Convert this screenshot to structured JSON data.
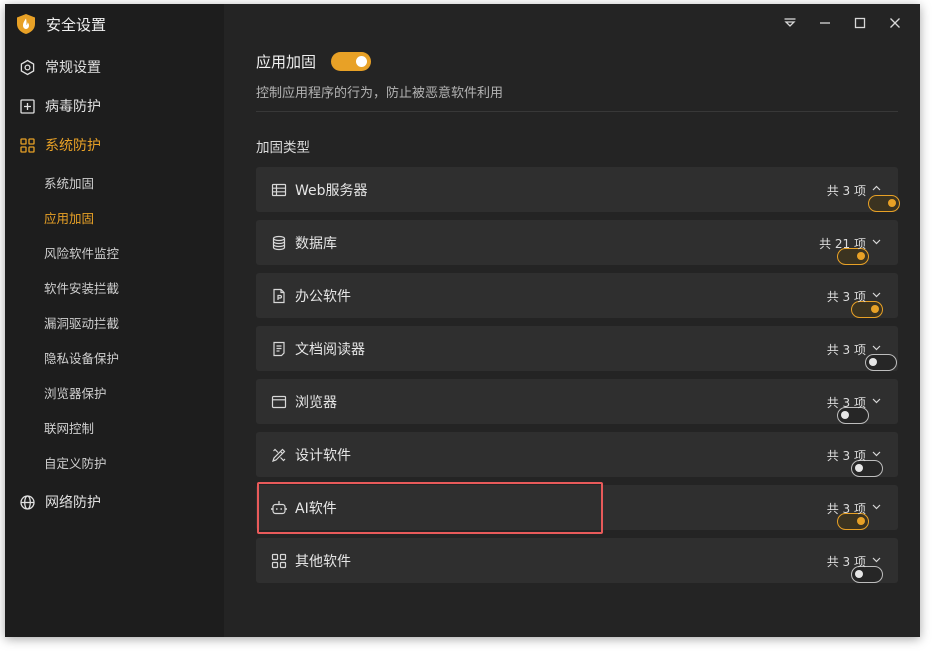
{
  "app": {
    "title": "安全设置"
  },
  "sidebar": {
    "nav": [
      {
        "label": "常规设置",
        "icon": "settings-icon"
      },
      {
        "label": "病毒防护",
        "icon": "plus-square-icon"
      },
      {
        "label": "系统防护",
        "icon": "grid-icon"
      },
      {
        "label": "网络防护",
        "icon": "globe-icon"
      }
    ],
    "sub_items": [
      "系统加固",
      "应用加固",
      "风险软件监控",
      "软件安装拦截",
      "漏洞驱动拦截",
      "隐私设备保护",
      "浏览器保护",
      "联网控制",
      "自定义防护"
    ],
    "active_nav": "系统防护",
    "active_sub": "应用加固"
  },
  "main": {
    "title": "应用加固",
    "enabled": true,
    "description": "控制应用程序的行为，防止被恶意软件利用",
    "section_label": "加固类型",
    "categories": [
      {
        "name": "Web服务器",
        "enabled": true,
        "count": "共 3 项",
        "expanded": true,
        "icon": "server-icon"
      },
      {
        "name": "数据库",
        "enabled": true,
        "count": "共 21 项",
        "expanded": false,
        "icon": "database-icon"
      },
      {
        "name": "办公软件",
        "enabled": true,
        "count": "共 3 项",
        "expanded": false,
        "icon": "office-file-icon"
      },
      {
        "name": "文档阅读器",
        "enabled": false,
        "count": "共 3 项",
        "expanded": false,
        "icon": "document-icon"
      },
      {
        "name": "浏览器",
        "enabled": false,
        "count": "共 3 项",
        "expanded": false,
        "icon": "browser-icon"
      },
      {
        "name": "设计软件",
        "enabled": false,
        "count": "共 3 项",
        "expanded": false,
        "icon": "design-tools-icon"
      },
      {
        "name": "AI软件",
        "enabled": true,
        "count": "共 3 项",
        "expanded": false,
        "icon": "robot-icon"
      },
      {
        "name": "其他软件",
        "enabled": false,
        "count": "共 3 项",
        "expanded": false,
        "icon": "apps-grid-icon"
      }
    ]
  },
  "colors": {
    "accent": "#e8a126",
    "highlight": "#e85a5a",
    "background": "#242424",
    "sidebar": "#1d1d1d",
    "row": "#2f2f2f"
  }
}
